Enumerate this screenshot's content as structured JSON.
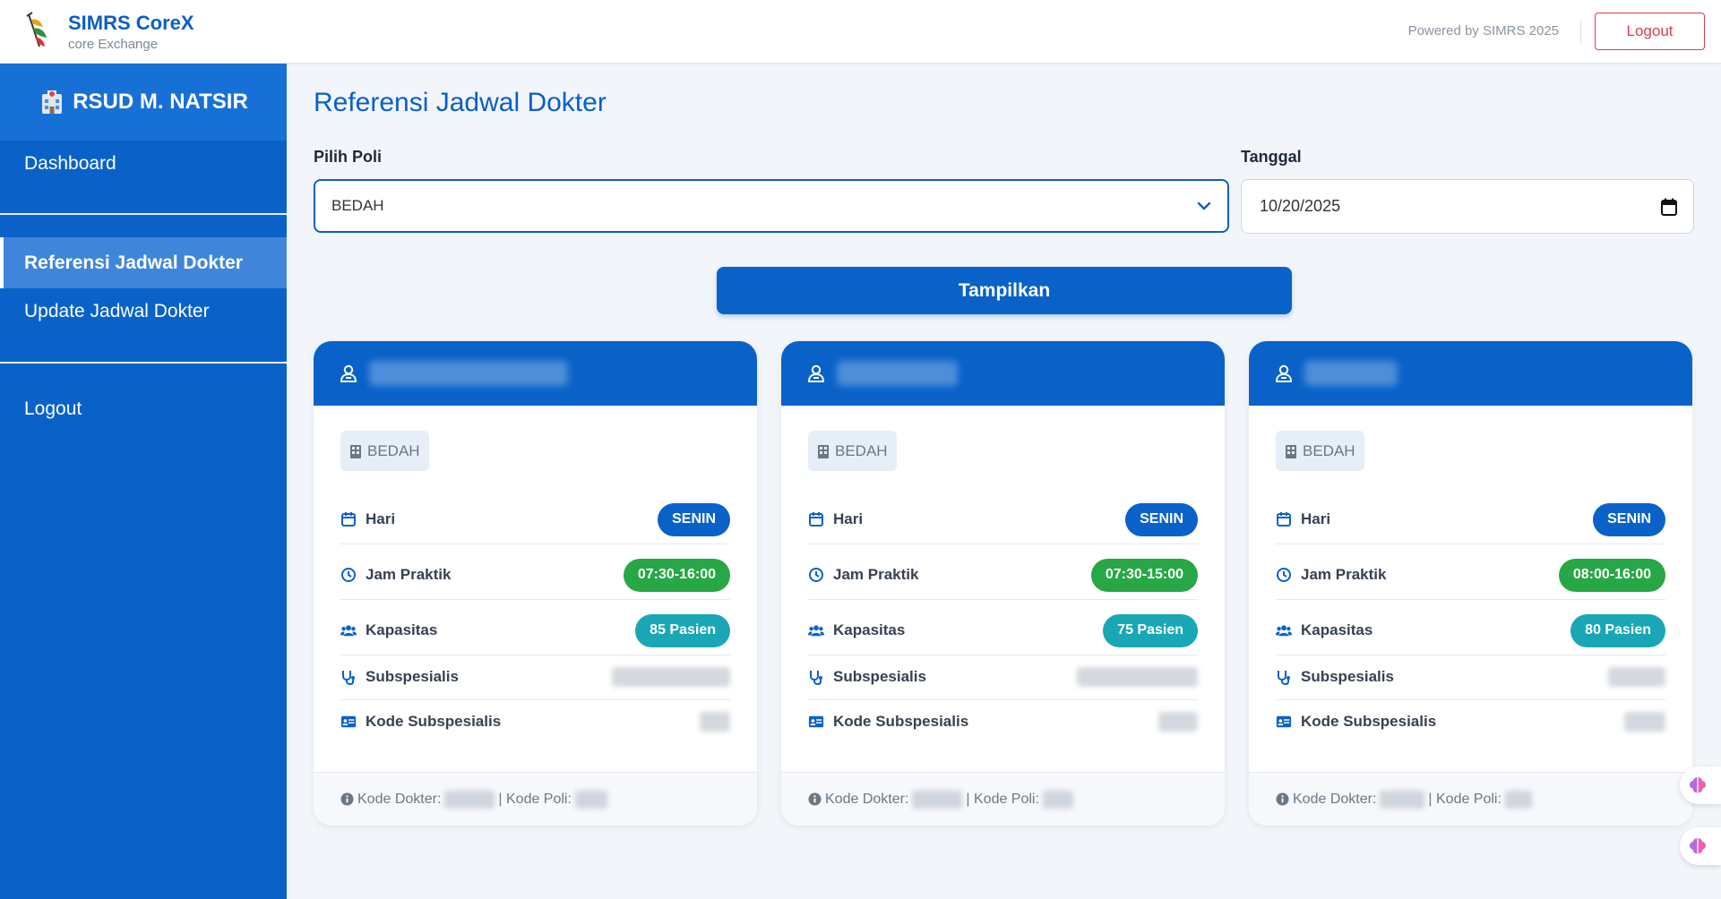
{
  "header": {
    "brand_title": "SIMRS CoreX",
    "brand_subtitle": "core Exchange",
    "powered_by": "Powered by SIMRS 2025",
    "logout_label": "Logout"
  },
  "sidebar": {
    "hospital_name": "RSUD M. NATSIR",
    "items": [
      {
        "label": "Dashboard",
        "active": false
      },
      {
        "label": "Referensi Jadwal Dokter",
        "active": true
      },
      {
        "label": "Update Jadwal Dokter",
        "active": false
      },
      {
        "label": "Logout",
        "active": false
      }
    ]
  },
  "main": {
    "title": "Referensi Jadwal Dokter",
    "poli_label": "Pilih Poli",
    "poli_value": "BEDAH",
    "date_label": "Tanggal",
    "date_value": "10/20/2025",
    "submit_label": "Tampilkan"
  },
  "card_labels": {
    "hari": "Hari",
    "jam": "Jam Praktik",
    "kapasitas": "Kapasitas",
    "subspesialis": "Subspesialis",
    "kode_subspesialis": "Kode Subspesialis",
    "kode_dokter": "Kode Dokter:",
    "kode_poli": "| Kode Poli:"
  },
  "cards": [
    {
      "poli": "BEDAH",
      "hari": "SENIN",
      "jam": "07:30-16:00",
      "kapasitas": "85 Pasien"
    },
    {
      "poli": "BEDAH",
      "hari": "SENIN",
      "jam": "07:30-15:00",
      "kapasitas": "75 Pasien"
    },
    {
      "poli": "BEDAH",
      "hari": "SENIN",
      "jam": "08:00-16:00",
      "kapasitas": "80 Pasien"
    }
  ],
  "colors": {
    "primary": "#0a62c9",
    "success": "#27a745",
    "info": "#1aa7b5",
    "danger": "#d63f4a"
  }
}
